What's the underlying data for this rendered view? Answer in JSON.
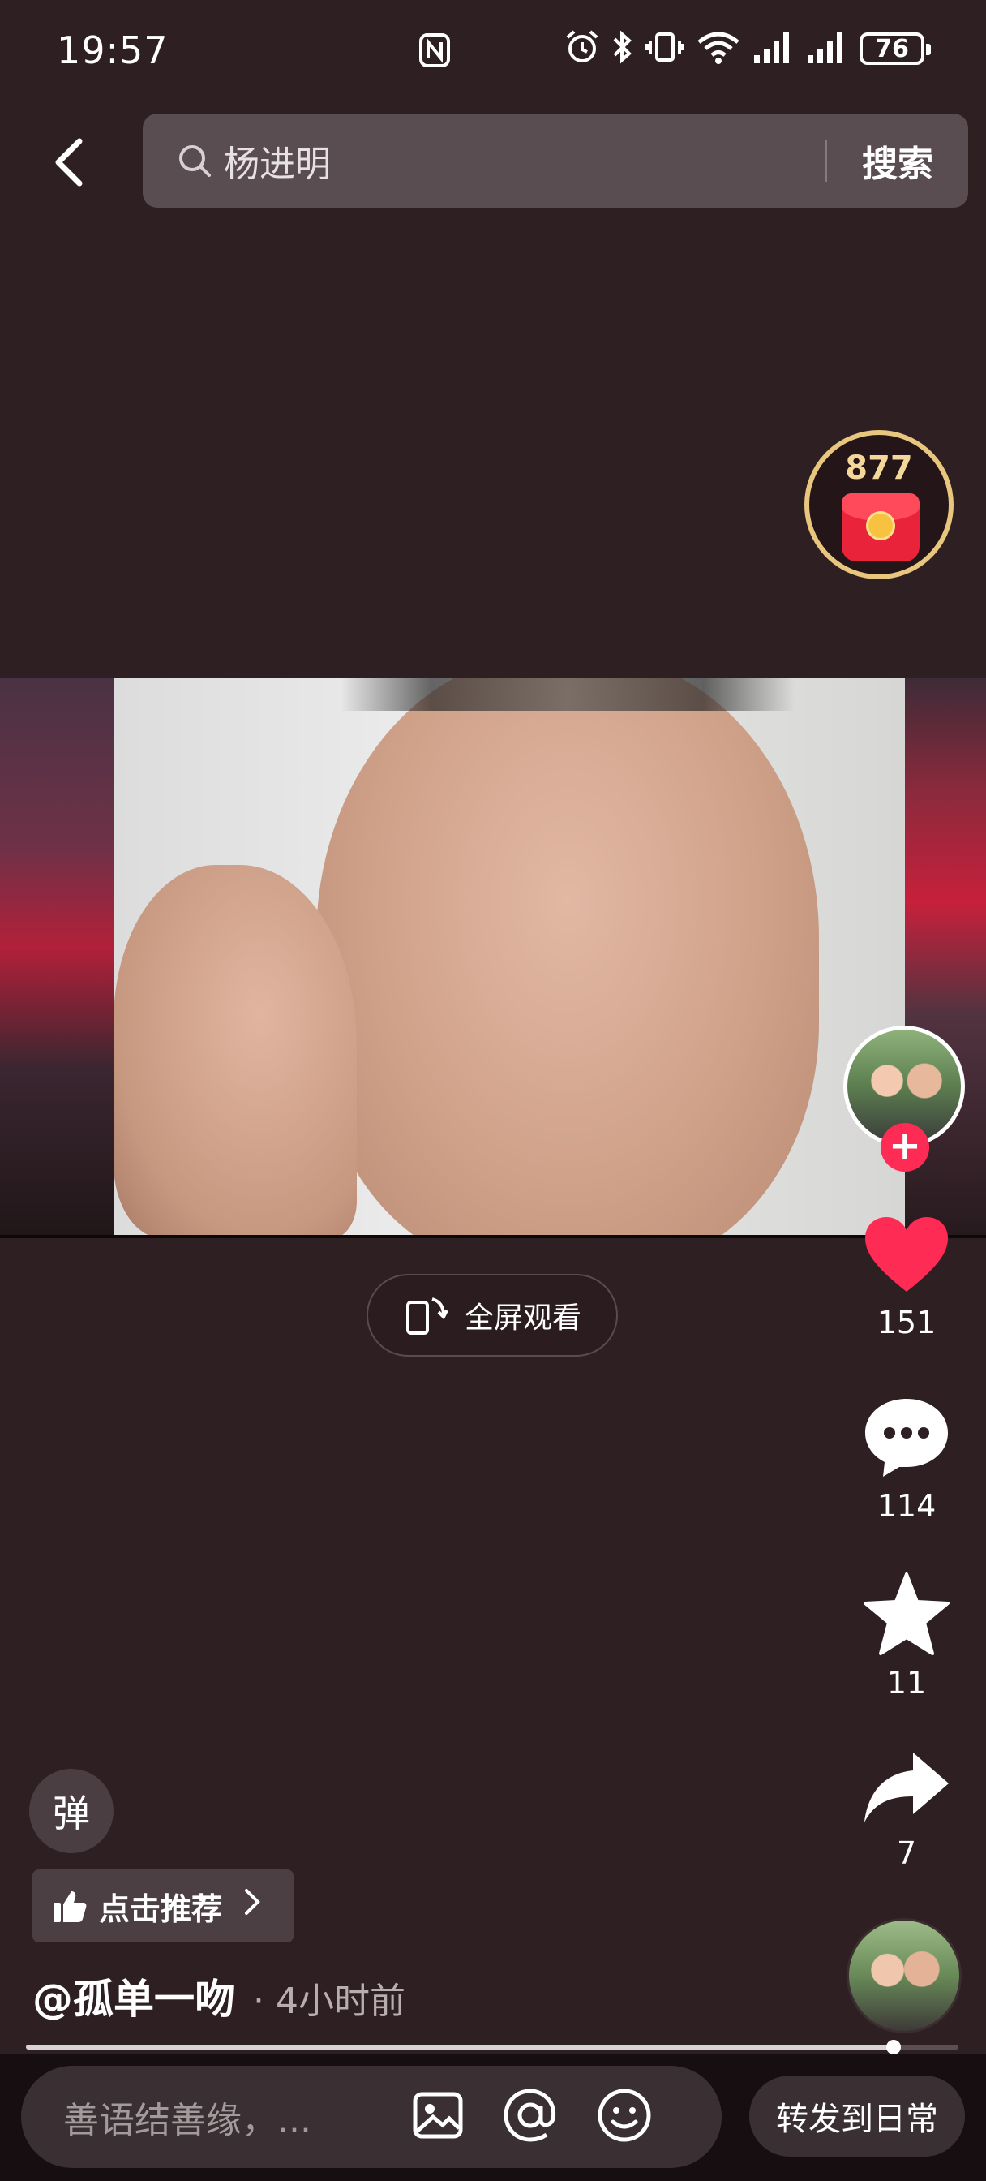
{
  "status_bar": {
    "time": "19:57",
    "battery": "76",
    "icons": [
      "nfc-icon",
      "alarm-icon",
      "bluetooth-icon",
      "vibrate-icon",
      "wifi-icon",
      "signal-icon",
      "signal-icon",
      "battery-icon"
    ]
  },
  "search": {
    "query": "杨进明",
    "button_label": "搜索"
  },
  "red_packet": {
    "count": "877"
  },
  "video": {
    "fullscreen_label": "全屏观看",
    "progress": 0.93
  },
  "actions": {
    "likes": "151",
    "comments": "114",
    "favorites": "11",
    "shares": "7",
    "like_color": "#fe2c55",
    "follow_color": "#fe2c55"
  },
  "post": {
    "danmu_label": "弹",
    "recommend_label": "点击推荐",
    "author": "@孤单一吻",
    "time": "· 4小时前"
  },
  "bottom_bar": {
    "comment_placeholder": "善语结善缘，...",
    "share_daily_label": "转发到日常"
  }
}
